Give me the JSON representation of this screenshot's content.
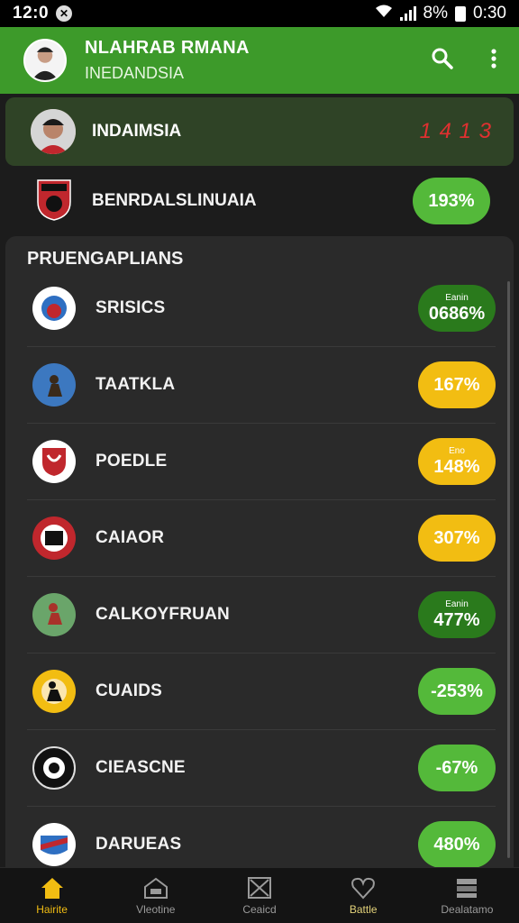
{
  "status": {
    "time": "12:0",
    "battery": "8%",
    "clock_right": "0:30"
  },
  "appbar": {
    "title": "NLAHRAB RMANA",
    "subtitle": "INEDANDSIA"
  },
  "topcard": {
    "name": "INDAIMSIA",
    "score": "1 4 1 3"
  },
  "second": {
    "name": "BENRDALSLINUAIA",
    "value": "193%"
  },
  "panel": {
    "heading": "PRUENGAPLIANS",
    "rows": [
      {
        "label": "SRISICS",
        "value": "0686%",
        "sub": "Eanin",
        "color": "#2a7a1c"
      },
      {
        "label": "TAATKLA",
        "value": "167%",
        "sub": "",
        "color": "#f2bd12"
      },
      {
        "label": "POEDLE",
        "value": "148%",
        "sub": "Eno",
        "color": "#f2bd12"
      },
      {
        "label": "CAIAOR",
        "value": "307%",
        "sub": "",
        "color": "#f2bd12"
      },
      {
        "label": "CALKOYFRUAN",
        "value": "477%",
        "sub": "Eanin",
        "color": "#2a7a1c"
      },
      {
        "label": "CUAIDS",
        "value": "-253%",
        "sub": "",
        "color": "#54b93a"
      },
      {
        "label": "CIEASCNE",
        "value": "-67%",
        "sub": "",
        "color": "#54b93a"
      },
      {
        "label": "DARUEAS",
        "value": "480%",
        "sub": "",
        "color": "#54b93a"
      }
    ]
  },
  "nav": [
    {
      "label": "Hairite",
      "icon": "home-icon"
    },
    {
      "label": "Vleotine",
      "icon": "store-icon"
    },
    {
      "label": "Ceaicd",
      "icon": "image-icon"
    },
    {
      "label": "Battle",
      "icon": "heart-icon"
    },
    {
      "label": "Dealatamo",
      "icon": "stack-icon"
    }
  ]
}
